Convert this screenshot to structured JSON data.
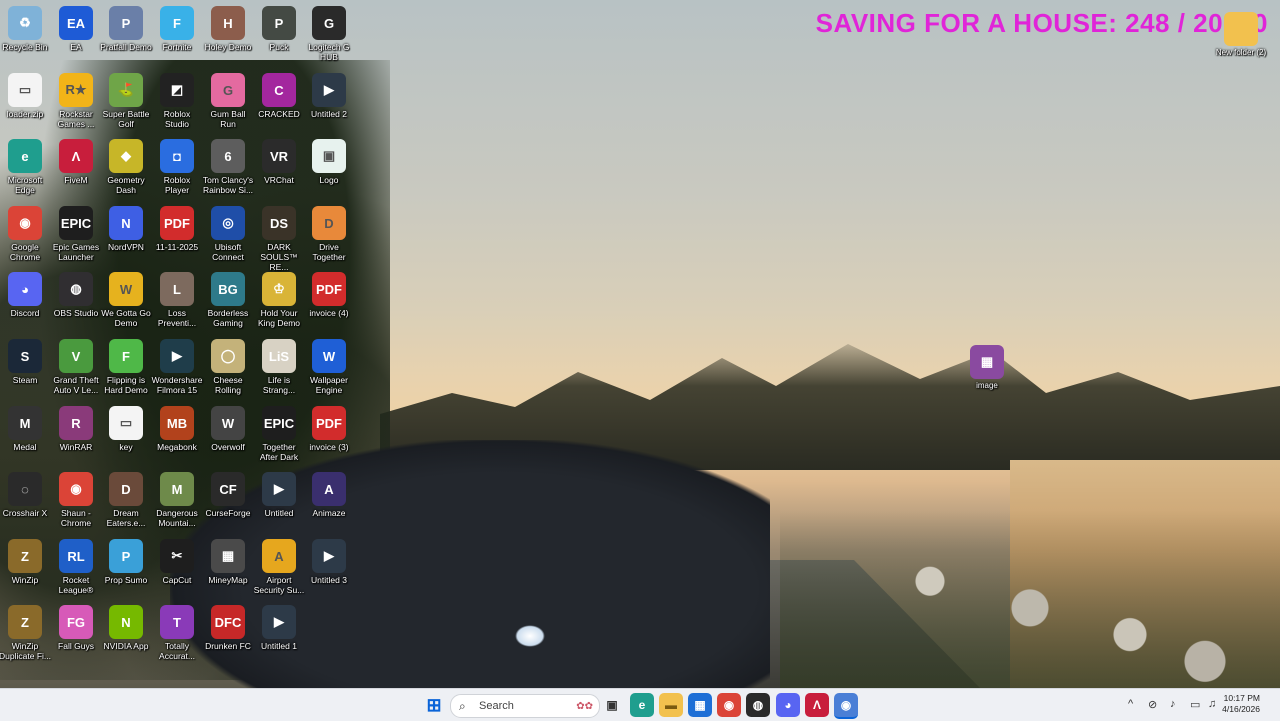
{
  "banner": {
    "text": "SAVING FOR A HOUSE: 248 / 20000",
    "color": "#e024d8"
  },
  "desktop_icons": [
    {
      "label": "Recycle Bin",
      "abbr": "♻",
      "color": "#7fb2d8"
    },
    {
      "label": "EA",
      "abbr": "EA",
      "color": "#1e5bd6"
    },
    {
      "label": "Pratfall Demo",
      "abbr": "P",
      "color": "#6a7fa8"
    },
    {
      "label": "Fortnite",
      "abbr": "F",
      "color": "#39b1e8"
    },
    {
      "label": "Holey Demo",
      "abbr": "H",
      "color": "#8c5d4c"
    },
    {
      "label": "Puck",
      "abbr": "P",
      "color": "#444a44"
    },
    {
      "label": "Logitech G HUB",
      "abbr": "G",
      "color": "#2a2a2a"
    },
    {
      "label": "loader.zip",
      "abbr": "▭",
      "color": "#f4f4f4"
    },
    {
      "label": "Rockstar Games ...",
      "abbr": "R★",
      "color": "#f2b418"
    },
    {
      "label": "Super Battle Golf",
      "abbr": "⛳",
      "color": "#6fa548"
    },
    {
      "label": "Roblox Studio",
      "abbr": "◩",
      "color": "#222222"
    },
    {
      "label": "Gum Ball Run",
      "abbr": "G",
      "color": "#e46aa0"
    },
    {
      "label": "CRACKED",
      "abbr": "C",
      "color": "#a3279e"
    },
    {
      "label": "Untitled 2",
      "abbr": "▶",
      "color": "#2d3a48"
    },
    {
      "label": "Microsoft Edge",
      "abbr": "e",
      "color": "#1f9e8e"
    },
    {
      "label": "FiveM",
      "abbr": "Λ",
      "color": "#c81e3c"
    },
    {
      "label": "Geometry Dash",
      "abbr": "◆",
      "color": "#c7b628"
    },
    {
      "label": "Roblox Player",
      "abbr": "◘",
      "color": "#2a6de0"
    },
    {
      "label": "Tom Clancy's Rainbow Si...",
      "abbr": "6",
      "color": "#5d5d5d"
    },
    {
      "label": "VRChat",
      "abbr": "VR",
      "color": "#2b2b2b"
    },
    {
      "label": "Logo",
      "abbr": "▣",
      "color": "#e7f2ee"
    },
    {
      "label": "Google Chrome",
      "abbr": "◉",
      "color": "#db4437"
    },
    {
      "label": "Epic Games Launcher",
      "abbr": "EPIC",
      "color": "#1e1e1e"
    },
    {
      "label": "NordVPN",
      "abbr": "N",
      "color": "#3e5fe4"
    },
    {
      "label": "11-11-2025",
      "abbr": "PDF",
      "color": "#d22c2c"
    },
    {
      "label": "Ubisoft Connect",
      "abbr": "◎",
      "color": "#1f4ea8"
    },
    {
      "label": "DARK SOULS™ RE...",
      "abbr": "DS",
      "color": "#3a3328"
    },
    {
      "label": "Drive Together",
      "abbr": "D",
      "color": "#e8893a"
    },
    {
      "label": "Discord",
      "abbr": "◕",
      "color": "#5865f2"
    },
    {
      "label": "OBS Studio",
      "abbr": "◍",
      "color": "#302e31"
    },
    {
      "label": "We Gotta Go Demo",
      "abbr": "W",
      "color": "#e6b21e"
    },
    {
      "label": "Loss Preventi...",
      "abbr": "L",
      "color": "#7d6a5e"
    },
    {
      "label": "Borderless Gaming",
      "abbr": "BG",
      "color": "#2e7a8a"
    },
    {
      "label": "Hold Your King Demo",
      "abbr": "♔",
      "color": "#d9b437"
    },
    {
      "label": "invoice (4)",
      "abbr": "PDF",
      "color": "#d22c2c"
    },
    {
      "label": "Steam",
      "abbr": "S",
      "color": "#1b2838"
    },
    {
      "label": "Grand Theft Auto V Le...",
      "abbr": "V",
      "color": "#4a9a3e"
    },
    {
      "label": "Flipping is Hard Demo",
      "abbr": "F",
      "color": "#4fb848"
    },
    {
      "label": "Wondershare Filmora 15",
      "abbr": "▶",
      "color": "#1f3d4a"
    },
    {
      "label": "Cheese Rolling",
      "abbr": "◯",
      "color": "#c4b27a"
    },
    {
      "label": "Life is Strang...",
      "abbr": "LiS",
      "color": "#d8d2c4"
    },
    {
      "label": "Wallpaper Engine",
      "abbr": "W",
      "color": "#1f5fd6"
    },
    {
      "label": "Medal",
      "abbr": "M",
      "color": "#333333"
    },
    {
      "label": "WinRAR",
      "abbr": "R",
      "color": "#8a3a7a"
    },
    {
      "label": "key",
      "abbr": "▭",
      "color": "#f4f4f4"
    },
    {
      "label": "Megabonk",
      "abbr": "MB",
      "color": "#b2421c"
    },
    {
      "label": "Overwolf",
      "abbr": "W",
      "color": "#444444"
    },
    {
      "label": "Together After Dark",
      "abbr": "EPIC",
      "color": "#1e1e1e"
    },
    {
      "label": "invoice (3)",
      "abbr": "PDF",
      "color": "#d22c2c"
    },
    {
      "label": "Crosshair X",
      "abbr": "◌",
      "color": "#2a2a2a"
    },
    {
      "label": "Shaun - Chrome",
      "abbr": "◉",
      "color": "#db4437"
    },
    {
      "label": "Dream Eaters.e...",
      "abbr": "D",
      "color": "#6a4a3a"
    },
    {
      "label": "Dangerous Mountai...",
      "abbr": "M",
      "color": "#6e8a4a"
    },
    {
      "label": "CurseForge",
      "abbr": "CF",
      "color": "#2a2a2a"
    },
    {
      "label": "Untitled",
      "abbr": "▶",
      "color": "#2d3a48"
    },
    {
      "label": "Animaze",
      "abbr": "A",
      "color": "#3a2f6e"
    },
    {
      "label": "WinZip",
      "abbr": "Z",
      "color": "#8a6a2a"
    },
    {
      "label": "Rocket League®",
      "abbr": "RL",
      "color": "#1f5fc8"
    },
    {
      "label": "Prop Sumo",
      "abbr": "P",
      "color": "#3aa0d8"
    },
    {
      "label": "CapCut",
      "abbr": "✂",
      "color": "#1e1e1e"
    },
    {
      "label": "MineyMap",
      "abbr": "▦",
      "color": "#4a4a4a"
    },
    {
      "label": "Airport Security Su...",
      "abbr": "A",
      "color": "#e6a71e"
    },
    {
      "label": "Untitled 3",
      "abbr": "▶",
      "color": "#2d3a48"
    },
    {
      "label": "WinZip Duplicate Fi...",
      "abbr": "Z",
      "color": "#8a6a2a"
    },
    {
      "label": "Fall Guys",
      "abbr": "FG",
      "color": "#d75ab8"
    },
    {
      "label": "NVIDIA App",
      "abbr": "N",
      "color": "#76b900"
    },
    {
      "label": "Totally Accurat...",
      "abbr": "T",
      "color": "#8a3ab8"
    },
    {
      "label": "Drunken FC",
      "abbr": "DFC",
      "color": "#c62828"
    },
    {
      "label": "Untitled 1",
      "abbr": "▶",
      "color": "#2d3a48"
    }
  ],
  "right_icons": [
    {
      "label": "New folder (2)",
      "abbr": "",
      "color": "#f2c14e"
    },
    {
      "label": "image",
      "abbr": "▦",
      "color": "#8a4aa0"
    }
  ],
  "taskbar": {
    "search_placeholder": "Search",
    "clock_time": "10:17 PM",
    "clock_date": "4/16/2026"
  }
}
